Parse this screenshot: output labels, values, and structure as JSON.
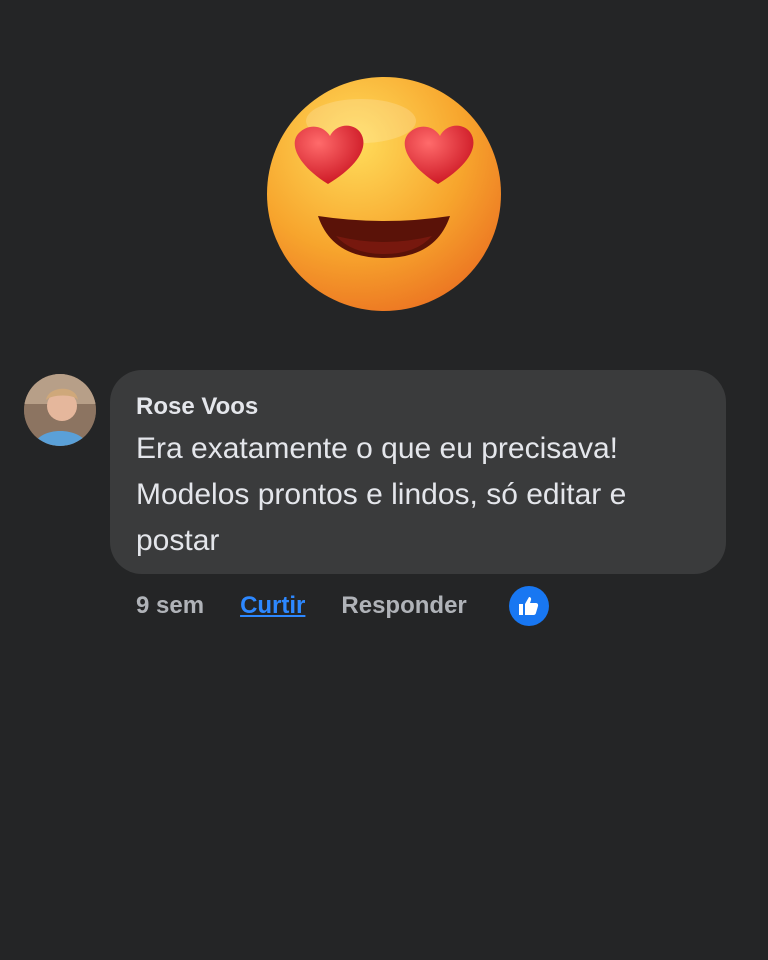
{
  "header_emoji": {
    "icon": "heart-eyes-smiling-face-icon"
  },
  "comment": {
    "author": "Rose Voos",
    "avatar_icon": "user-avatar-photo",
    "lines": [
      "Era exatamente o que eu precisava!",
      "Modelos prontos e lindos, só editar e",
      "postar"
    ],
    "timestamp": "9 sem",
    "like_label": "Curtir",
    "reply_label": "Responder",
    "reaction_icon": "thumbs-up-icon"
  },
  "colors": {
    "background": "#242526",
    "bubble": "#3a3b3c",
    "text": "#e4e6eb",
    "muted": "#b0b3b8",
    "link": "#2d88ff",
    "reaction": "#1877f2"
  }
}
